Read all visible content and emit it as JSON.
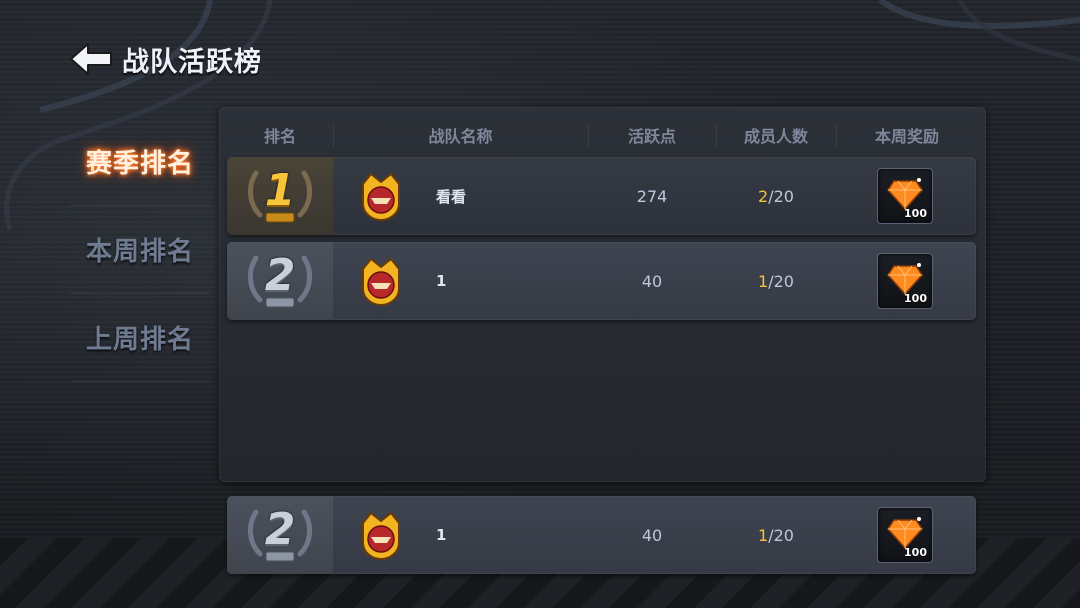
{
  "header": {
    "title": "战队活跃榜"
  },
  "sidebar": {
    "tabs": [
      {
        "label": "赛季排名",
        "active": true
      },
      {
        "label": "本周排名",
        "active": false
      },
      {
        "label": "上周排名",
        "active": false
      }
    ]
  },
  "table": {
    "columns": [
      "排名",
      "战队名称",
      "活跃点",
      "成员人数",
      "本周奖励"
    ],
    "rows": [
      {
        "rank": "1",
        "medal": "gold",
        "team_name": "看看",
        "activity": "274",
        "members_current": "2",
        "members_sep": "/20",
        "reward_qty": "100",
        "reward_icon": "orange-gem-icon"
      },
      {
        "rank": "2",
        "medal": "silver",
        "team_name": "1",
        "activity": "40",
        "members_current": "1",
        "members_sep": "/20",
        "reward_qty": "100",
        "reward_icon": "orange-gem-icon"
      }
    ],
    "my_team": {
      "rank": "2",
      "medal": "silver",
      "team_name": "1",
      "activity": "40",
      "members_current": "1",
      "members_sep": "/20",
      "reward_qty": "100",
      "reward_icon": "orange-gem-icon"
    }
  },
  "colors": {
    "gold": "#f5c23a",
    "active_tab_glow": "#ff7a2a",
    "panel": "#2c3038"
  }
}
